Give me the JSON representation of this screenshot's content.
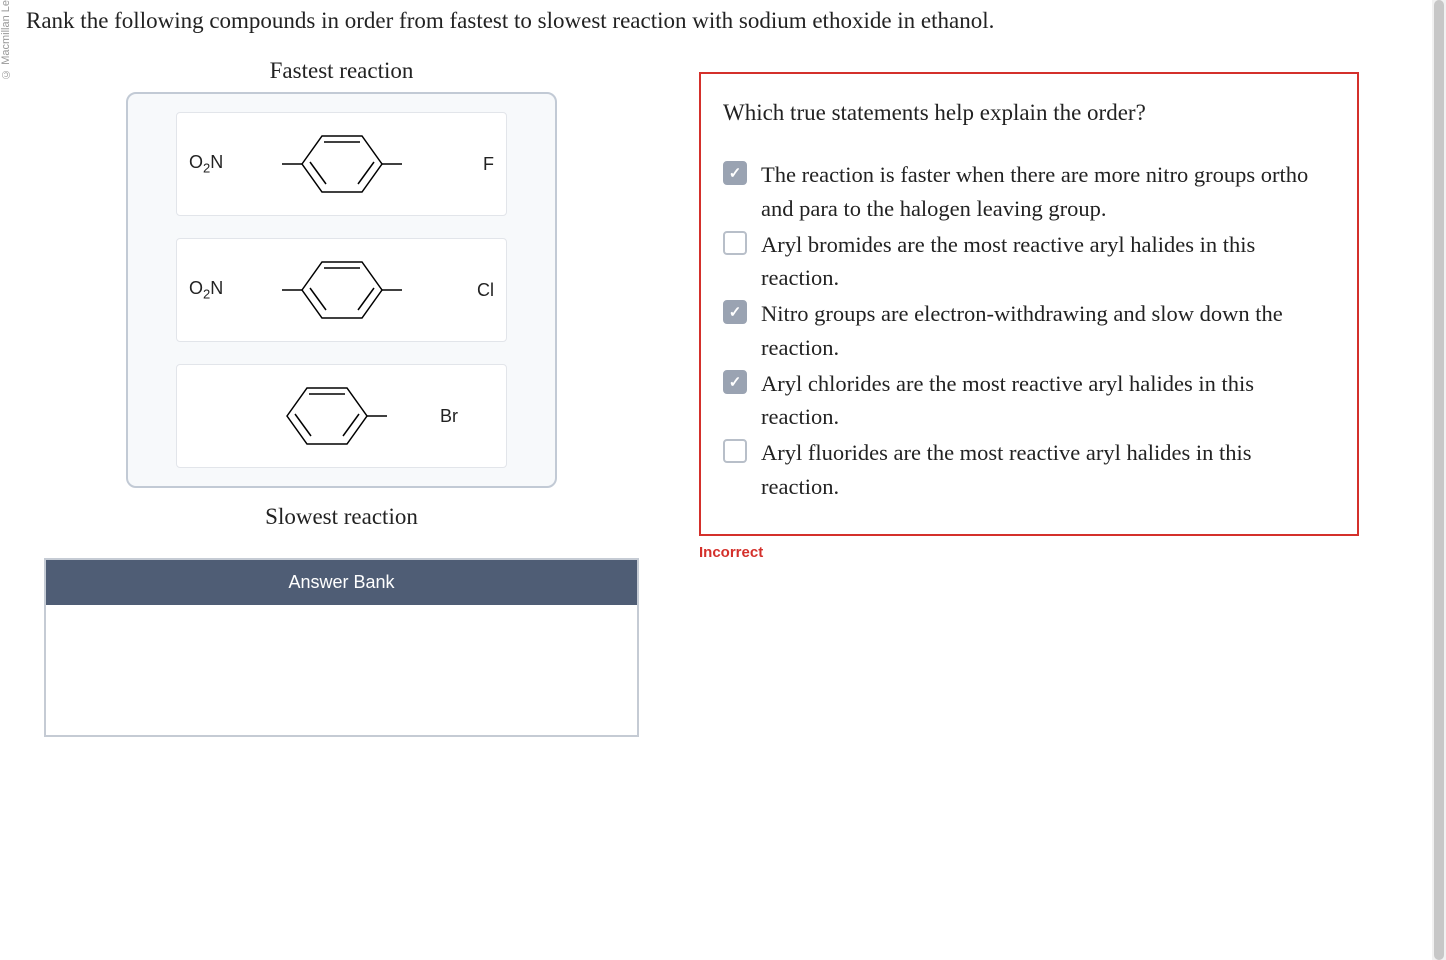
{
  "copyright": "© Macmillan Le",
  "question": "Rank the following compounds in order from fastest to slowest reaction with sodium ethoxide in ethanol.",
  "labels": {
    "fastest": "Fastest reaction",
    "slowest": "Slowest reaction",
    "answer_bank": "Answer Bank"
  },
  "compounds": [
    {
      "left_sub": "O2N",
      "right_sub": "F",
      "para": true
    },
    {
      "left_sub": "O2N",
      "right_sub": "Cl",
      "para": true
    },
    {
      "left_sub": "",
      "right_sub": "Br",
      "para": false
    }
  ],
  "statements_panel": {
    "title": "Which true statements help explain the order?",
    "items": [
      {
        "checked": true,
        "text": "The reaction is faster when there are more nitro groups ortho and para to the halogen leaving group."
      },
      {
        "checked": false,
        "text": "Aryl bromides are the most reactive aryl halides in this reaction."
      },
      {
        "checked": true,
        "text": "Nitro groups are electron-withdrawing and slow down the reaction."
      },
      {
        "checked": true,
        "text": "Aryl chlorides are the most reactive aryl halides in this reaction."
      },
      {
        "checked": false,
        "text": "Aryl fluorides are the most reactive aryl halides in this reaction."
      }
    ],
    "feedback": "Incorrect"
  }
}
